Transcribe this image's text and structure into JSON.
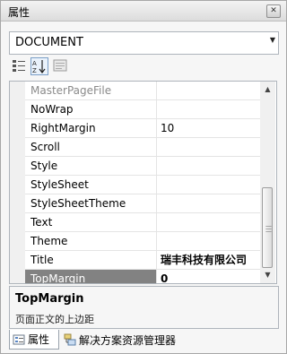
{
  "window": {
    "title": "属性"
  },
  "object_selector": {
    "value": "DOCUMENT"
  },
  "properties": [
    {
      "name": "MasterPageFile",
      "value": ""
    },
    {
      "name": "NoWrap",
      "value": ""
    },
    {
      "name": "RightMargin",
      "value": "10"
    },
    {
      "name": "Scroll",
      "value": ""
    },
    {
      "name": "Style",
      "value": ""
    },
    {
      "name": "StyleSheet",
      "value": ""
    },
    {
      "name": "StyleSheetTheme",
      "value": ""
    },
    {
      "name": "Text",
      "value": ""
    },
    {
      "name": "Theme",
      "value": ""
    },
    {
      "name": "Title",
      "value": "瑞丰科技有限公司"
    },
    {
      "name": "TopMargin",
      "value": "0"
    }
  ],
  "description": {
    "title": "TopMargin",
    "text": "页面正文的上边距"
  },
  "tabs": [
    {
      "label": "属性",
      "icon": "properties-icon"
    },
    {
      "label": "解决方案资源管理器",
      "icon": "solution-explorer-icon"
    }
  ]
}
